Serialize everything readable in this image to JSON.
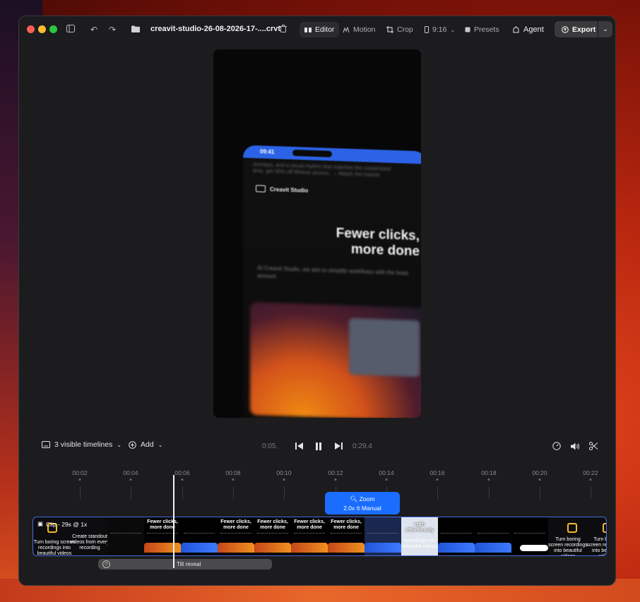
{
  "titlebar": {
    "file_name": "creavit-studio-26-08-2026-17-....crvt",
    "tabs": [
      {
        "label": "Editor",
        "icon": "editor-icon",
        "active": true
      },
      {
        "label": "Motion",
        "icon": "motion-icon",
        "active": false
      },
      {
        "label": "Crop",
        "icon": "crop-icon",
        "active": false
      }
    ],
    "aspect": "9:16",
    "presets": "Presets",
    "agent": "Agent",
    "export": "Export"
  },
  "preview": {
    "phone_time": "09:41",
    "brand": "Creavit Studio",
    "headline_line1": "Fewer clicks,",
    "headline_line2": "more done",
    "blur_top_text": "overlays, and a visual rhythm that matches the customized time, get 30% off lifetime access. → Watch the tutorial",
    "blur_sub_text": "At Creavit Studio, we aim to simplify workflows with the least amount"
  },
  "controls": {
    "timelines": "3 visible timelines",
    "add": "Add",
    "current_time": "0:05.",
    "total_time": "0:29.4"
  },
  "ruler": {
    "ticks": [
      "00:02",
      "00:04",
      "00:06",
      "00:08",
      "00:10",
      "00:12",
      "00:14",
      "00:16",
      "00:18",
      "00:20",
      "00:22"
    ]
  },
  "zoom": {
    "title": "Zoom",
    "detail": "2.0x",
    "mode": "Manual"
  },
  "clip": {
    "label": "Clip - 29s @ 1x",
    "frame_text_1": "Turn boring screen recordings into beautiful videos",
    "frame_text_2": "Create standout videos from every recording",
    "frame_headline": "Fewer clicks, more done",
    "frame_text_3": "with effortlessly",
    "frame_text_4": "recordings into beautiful videos",
    "frame_text_5": "Turn boring screen recordings into beautiful videos"
  },
  "tilt": {
    "label": "Tilt reveal"
  },
  "colors": {
    "accent": "#1a6dff",
    "clip_border": "#4b69e0",
    "window_bg": "#1c1c1e"
  }
}
